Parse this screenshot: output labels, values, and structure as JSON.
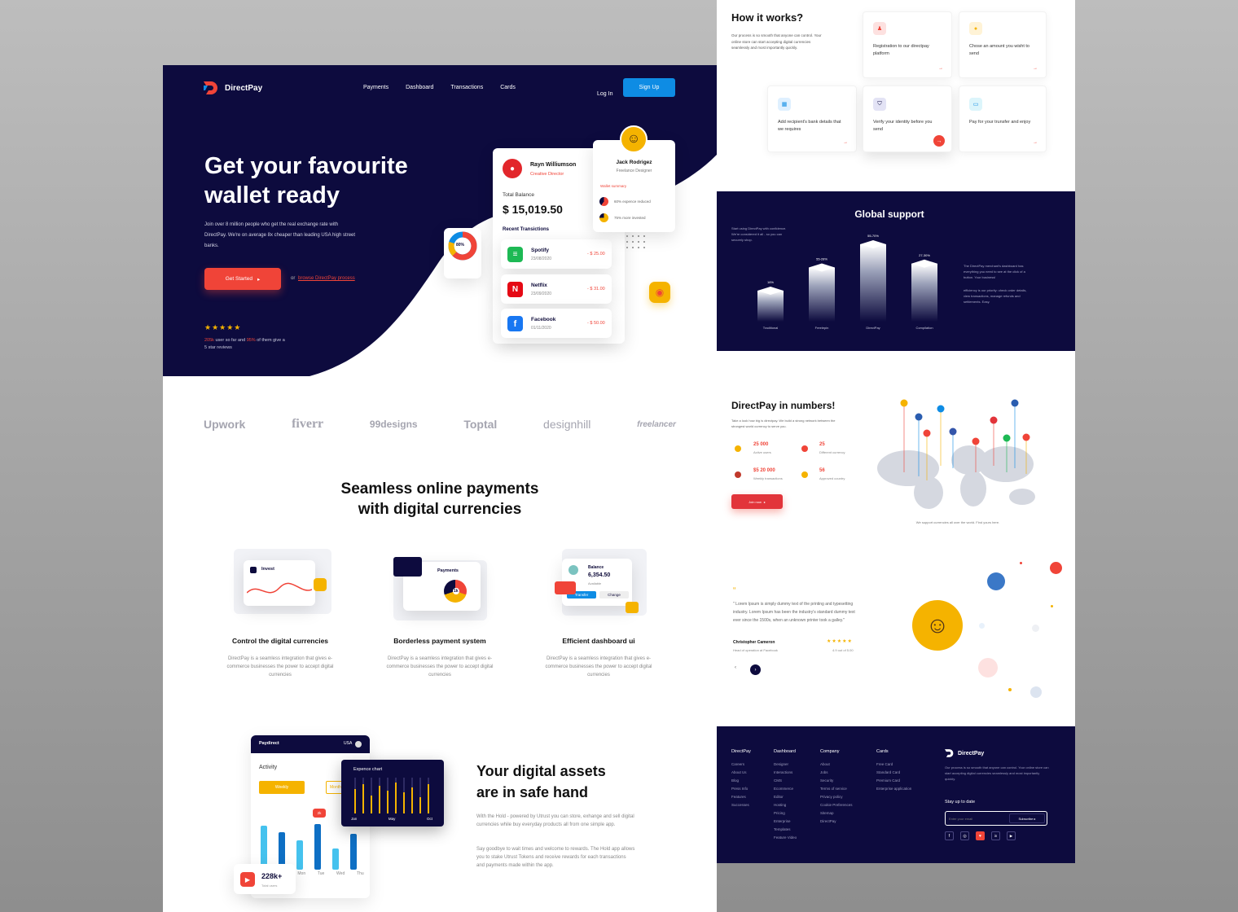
{
  "nav": {
    "brand": "DirectPay",
    "links": [
      "Payments",
      "Dashboard",
      "Transactions",
      "Cards"
    ],
    "login": "Log In",
    "signup": "Sign Up"
  },
  "hero": {
    "title_line1": "Get your favourite",
    "title_line2": "wallet ready",
    "subtitle": "Join over 8 million people who get the real exchange rate with DirectPay. We're on average 8x cheaper than leading USA high street banks.",
    "cta": "Get Started",
    "or": "or",
    "browse": "browse DirectPay  process",
    "rating_highlight1": "205k",
    "rating_text1": " user so far and ",
    "rating_highlight2": "95%",
    "rating_text2": " of them give a 5 star reviews",
    "stars": "★★★★★"
  },
  "wallet": {
    "user": "Rayn Williumson",
    "role": "Creative Director",
    "balance_label": "Total Balance",
    "balance": "$ 15,019.50",
    "recent": "Recent Transictions",
    "transactions": [
      {
        "name": "Spotify",
        "date": "23/08/2020",
        "amount": "- $ 25.00",
        "icon": "spotify-icon",
        "color": "#1db954",
        "glyph": "≡"
      },
      {
        "name": "Netflix",
        "date": "23/09/2020",
        "amount": "- $ 31.00",
        "icon": "netflix-icon",
        "color": "#e50914",
        "glyph": "N"
      },
      {
        "name": "Facebook",
        "date": "01/11/2020",
        "amount": "- $ 50.00",
        "icon": "facebook-icon",
        "color": "#1877f2",
        "glyph": "f"
      }
    ],
    "pie_label": "80%"
  },
  "profile": {
    "name": "Jack Rodrigez",
    "role": "Freelance Designer",
    "summary": "Wallet summary",
    "stat1": "60% expence reduced",
    "stat2": "75% more invested"
  },
  "brands": [
    "Upwork",
    "fiverr",
    "99designs",
    "Toptal",
    "designhill",
    "freelancer"
  ],
  "seamless": {
    "title1": "Seamless online payments",
    "title2": "with digital currencies"
  },
  "features": [
    {
      "title": "Control the digital currencies",
      "desc": "DirectPay is a seamless integration that gives e-commerce businesses the power to accept digital currencies",
      "mock": "Invest"
    },
    {
      "title": "Borderless payment system",
      "desc": "DirectPay is a seamless integration that gives e-commerce businesses the power to accept digital currencies",
      "mock": "Payments",
      "badge": "1k"
    },
    {
      "title": "Efficient dashboard ui",
      "desc": "DirectPay is a seamless integration that gives e-commerce businesses the power to accept digital currencies",
      "mock": "Balance",
      "amount": "6,354.50",
      "sub": "Available",
      "transfer": "Transfer",
      "change": "Change"
    }
  ],
  "safe": {
    "title1": "Your digital assets",
    "title2": "are in safe hand",
    "p1": "With the Hold - powered by Utrust you can store, exhange and sell digital currencies while buy everyday products all from one simple app.",
    "p2": "Say goodbye to wait times and welcome to rewards. The Hold app allows you to stake Utrust Tokens and receive rewards for each transactions and payments made within the app.",
    "app_brand": "Paydirect",
    "country": "USA",
    "activity": "Activity",
    "weekly": "Weekly",
    "monthly": "Monthly",
    "days": [
      "Mon",
      "Tue",
      "Wed",
      "Thu"
    ],
    "badge": "2k",
    "chart_title": "Expence chart",
    "chart_months": [
      "Jan",
      "May",
      "Oct"
    ],
    "users": "228k+",
    "users_label": "Total users"
  },
  "how": {
    "title": "How it works?",
    "desc": "Our process is so smooth that anyone can control. Your online store can start accepting digital currencies seamlessly and most importantly quickly.",
    "steps": [
      {
        "label": "Registration to our directpay platform",
        "icon": "user-icon"
      },
      {
        "label": "Chose an amount you wisht to send",
        "icon": "coin-icon"
      },
      {
        "label": "Add recipient's bank details that we requires",
        "icon": "bank-icon"
      },
      {
        "label": "Verify your identity before you send",
        "icon": "shield-icon"
      },
      {
        "label": "Pay for your trunsfer and enjoy",
        "icon": "card-icon"
      }
    ]
  },
  "global": {
    "title": "Global support",
    "left_text": "Start using DirectPay with confidence. We're considered it all - so you can securely shop.",
    "right_text1": "The DirectPay merchant's dashboard has everything you need to see at the click of a button. Your business!",
    "right_text2": "efficiency is our priority: check order details, view transactions, manage refunds and settlements. Easy.",
    "bars": [
      {
        "label": "Traditional",
        "pct": "16%",
        "value": 16
      },
      {
        "label": "Freelepin",
        "pct": "55-28%",
        "value": 28
      },
      {
        "label": "DirectPay",
        "pct": "55-70%",
        "value": 40
      },
      {
        "label": "Compilation",
        "pct": "27-30%",
        "value": 30
      }
    ]
  },
  "numbers": {
    "title": "DirectPay in numbers!",
    "desc": "Take a look how big is directpay. We build a strong network between the strongest world currency to serve you.",
    "stats": [
      {
        "value": "25 000",
        "label": "Active users"
      },
      {
        "value": "25",
        "label": "Different currency"
      },
      {
        "value": "$5 20 000",
        "label": "Weekly transactions"
      },
      {
        "value": "56",
        "label": "Approved country"
      }
    ],
    "cta": "Join now",
    "map_caption": "We support currencies all over the world. Find yours here."
  },
  "testimonial": {
    "quote": "\" Lorem Ipsum is simply dummy text of the printing and typesetting industry. Lorem Ipsum has been the industry's standard dummy text ever since the 1500s, when an unknown printer took a galley.\"",
    "name": "Christopher Cameron",
    "role": "Head of operation at Facebook",
    "rating": "4.9 out of 5.00",
    "stars": "★★★★★"
  },
  "footer": {
    "cols": [
      {
        "title": "DirectPay",
        "links": [
          "Careers",
          "About Us",
          "Blog",
          "Press Info",
          "Features",
          "Successes"
        ]
      },
      {
        "title": "Dashboard",
        "links": [
          "Designer",
          "Interactions",
          "CMS",
          "Ecommerce",
          "Editor",
          "Hosting",
          "Pricing",
          "Enterprise",
          "Templates",
          "Feature Video"
        ]
      },
      {
        "title": "Company",
        "links": [
          "About",
          "Jobs",
          "Security",
          "Terms of service",
          "Privacy policy",
          "Cookie Preferences",
          "Sitemap",
          "DirectPay"
        ]
      },
      {
        "title": "Cards",
        "links": [
          "Free Card",
          "Standard Card",
          "Premium Card",
          "Enterprise application"
        ]
      }
    ],
    "brand": "DirectPay",
    "desc": "Our process is so smooth that anyone can control. Your online store can start accepting digital currencies seamlessly and most importantly quickly.",
    "stay": "Stay up to date",
    "email_placeholder": "Enter your email",
    "subscribe": "Subscribe",
    "socials": [
      "f",
      "◎",
      "♥",
      "in",
      "▶"
    ]
  },
  "colors": {
    "navy": "#0d0b3e",
    "accent": "#f04438",
    "blue": "#0e8ce4",
    "yellow": "#f5b300"
  }
}
